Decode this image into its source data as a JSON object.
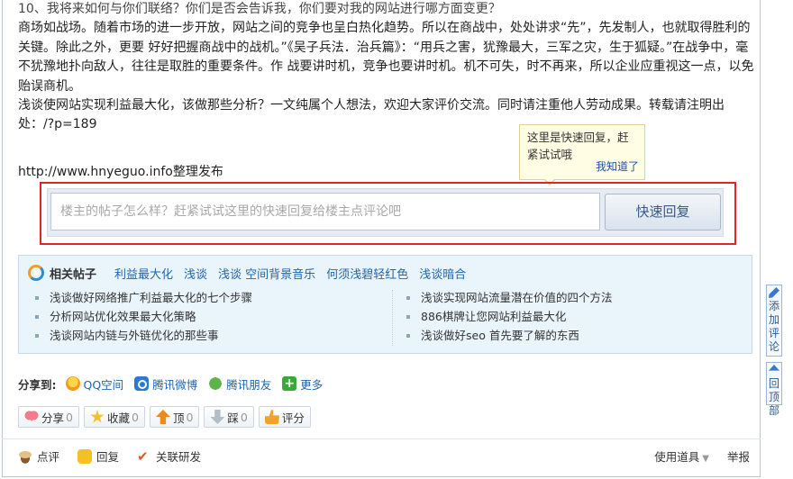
{
  "article": {
    "lines": [
      "10、我将来如何与你们联络？你们是否会告诉我，你们要对我的网站进行哪方面变更？",
      "商场如战场。随着市场的进一步开放，网站之间的竞争也呈白热化趋势。所以在商战中，处处讲求“先”，先发制人，也就取得胜利的关键。除此之外，更要 好好把握商战中的战机。”《吴子兵法．治兵篇》：“用兵之害，犹豫最大，三军之灾，生于狐疑。”在战争中，毫不犹豫地扑向敌人，往往是取胜的重要条件。作 战要讲时机，竞争也要讲时机。机不可失，时不再来，所以企业应重视这一点，以免贻误商机。",
      "浅谈使网站实现利益最大化，该做那些分析？一文纯属个人想法，欢迎大家评价交流。同时请注重他人劳动成果。转载请注明出处：/?p=189"
    ],
    "source": "http://www.hnyeguo.info整理发布"
  },
  "tip": {
    "text": "这里是快速回复，赶紧试试哦",
    "close": "我知道了"
  },
  "reply": {
    "placeholder": "楼主的帖子怎么样？赶紧试试这里的快速回复给楼主点评论吧",
    "button": "快速回复"
  },
  "related": {
    "title": "相关帖子",
    "tags": [
      "利益最大化",
      "浅谈",
      "浅谈 空间背景音乐",
      "何须浅碧轻红色",
      "浅谈暗合"
    ],
    "left": [
      "浅谈做好网络推广利益最大化的七个步骤",
      "分析网站优化效果最大化策略",
      "浅谈网站内链与外链优化的那些事"
    ],
    "right": [
      "浅谈实现网站流量潜在价值的四个方法",
      "886棋牌让您网站利益最大化",
      "浅谈做好seo 首先要了解的东西"
    ]
  },
  "share": {
    "label": "分享到:",
    "items": [
      "QQ空间",
      "腾讯微博",
      "腾讯朋友",
      "更多"
    ]
  },
  "actions": [
    {
      "label": "分享",
      "count": "0"
    },
    {
      "label": "收藏",
      "count": "0"
    },
    {
      "label": "顶",
      "count": "0"
    },
    {
      "label": "踩",
      "count": "0"
    },
    {
      "label": "评分",
      "count": ""
    }
  ],
  "footer": {
    "comment": "点评",
    "reply": "回复",
    "related": "关联研发",
    "tools": "使用道具",
    "report": "举报"
  },
  "side": {
    "comment": [
      "添",
      "加",
      "评",
      "论"
    ],
    "top": [
      "回",
      "顶",
      "部"
    ]
  }
}
